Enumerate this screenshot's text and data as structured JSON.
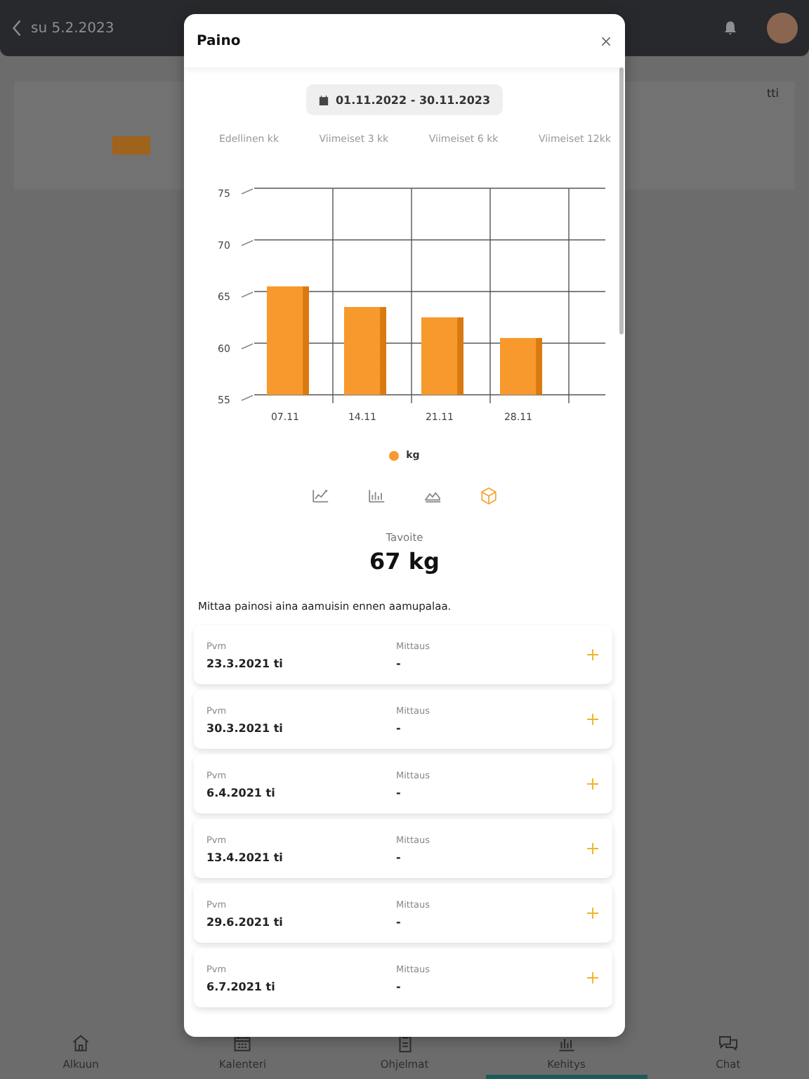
{
  "app_bar": {
    "date": "su 5.2.2023"
  },
  "background_card": {
    "text": "tti"
  },
  "dialog": {
    "title": "Paino",
    "date_range": "01.11.2022 - 30.11.2023",
    "range_tabs": [
      "Edellinen kk",
      "Viimeiset 3 kk",
      "Viimeiset 6 kk",
      "Viimeiset 12kk"
    ],
    "chart_data": {
      "type": "bar",
      "categories": [
        "07.11",
        "14.11",
        "21.11",
        "28.11"
      ],
      "series": [
        {
          "name": "kg",
          "color": "#f7992c",
          "values": [
            65.5,
            63.5,
            62.5,
            60.5
          ]
        }
      ],
      "ylim": [
        55,
        75
      ],
      "grid": true,
      "yticks": [
        55,
        60,
        65,
        70,
        75
      ]
    },
    "chart_types": [
      {
        "kind": "line",
        "selected": false
      },
      {
        "kind": "bar",
        "selected": false
      },
      {
        "kind": "area",
        "selected": false
      },
      {
        "kind": "cube",
        "selected": true
      }
    ],
    "goal": {
      "label": "Tavoite",
      "value": "67 kg"
    },
    "hint": "Mittaa painosi aina aamuisin ennen aamupalaa.",
    "entries": [
      {
        "date_label": "Pvm",
        "date": "23.3.2021 ti",
        "measure_label": "Mittaus",
        "measure": "-"
      },
      {
        "date_label": "Pvm",
        "date": "30.3.2021 ti",
        "measure_label": "Mittaus",
        "measure": "-"
      },
      {
        "date_label": "Pvm",
        "date": "6.4.2021 ti",
        "measure_label": "Mittaus",
        "measure": "-"
      },
      {
        "date_label": "Pvm",
        "date": "13.4.2021 ti",
        "measure_label": "Mittaus",
        "measure": "-"
      },
      {
        "date_label": "Pvm",
        "date": "29.6.2021 ti",
        "measure_label": "Mittaus",
        "measure": "-"
      },
      {
        "date_label": "Pvm",
        "date": "6.7.2021 ti",
        "measure_label": "Mittaus",
        "measure": "-"
      }
    ]
  },
  "bottom_nav": [
    {
      "label": "Alkuun",
      "kind": "home",
      "selected": false
    },
    {
      "label": "Kalenteri",
      "kind": "calendar",
      "selected": false
    },
    {
      "label": "Ohjelmat",
      "kind": "clipboard",
      "selected": false
    },
    {
      "label": "Kehitys",
      "kind": "chart",
      "selected": true
    },
    {
      "label": "Chat",
      "kind": "chat",
      "selected": false
    }
  ]
}
